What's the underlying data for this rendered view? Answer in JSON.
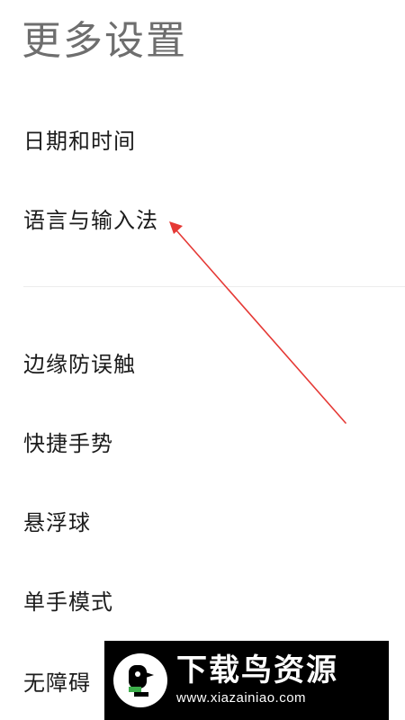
{
  "header": {
    "title": "更多设置"
  },
  "menu": {
    "group1": [
      {
        "label": "日期和时间"
      },
      {
        "label": "语言与输入法"
      }
    ],
    "group2": [
      {
        "label": "边缘防误触"
      },
      {
        "label": "快捷手势"
      },
      {
        "label": "悬浮球"
      },
      {
        "label": "单手模式"
      },
      {
        "label": "无障碍"
      }
    ]
  },
  "annotation": {
    "arrow_color": "#e53935"
  },
  "watermark": {
    "title": "下载鸟资源",
    "url": "www.xiazainiao.com",
    "logo_icon": "bird-logo-icon"
  }
}
